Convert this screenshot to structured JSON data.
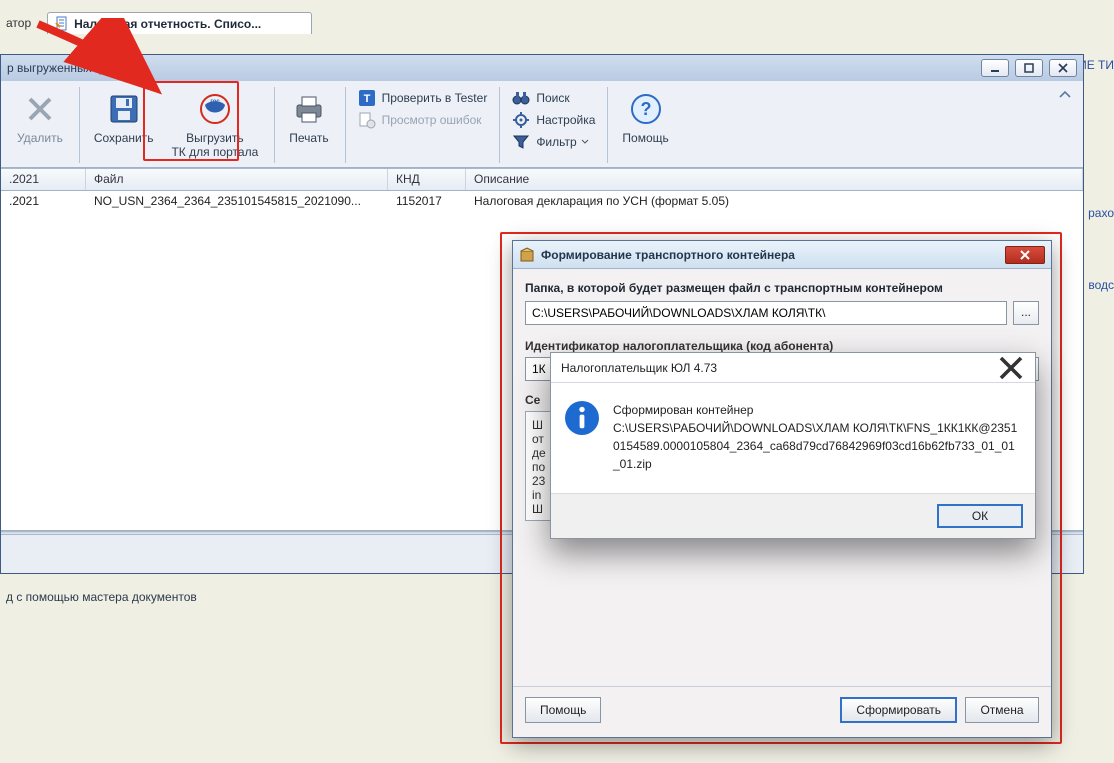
{
  "tabs": {
    "lead": "атор",
    "active": "Налоговая отчетность. Списо..."
  },
  "toolwin": {
    "title": "р выгруженных файлов"
  },
  "ribbon": {
    "delete": "Удалить",
    "save": "Сохранить",
    "export": "Выгрузить\nТК для портала",
    "print": "Печать",
    "tester": "Проверить в Tester",
    "errors": "Просмотр ошибок",
    "search": "Поиск",
    "settings": "Настройка",
    "filter": "Фильтр",
    "help": "Помощь"
  },
  "grid": {
    "headers": {
      "date": ".2021",
      "file": "Файл",
      "knd": "КНД",
      "desc": "Описание"
    },
    "rows": [
      {
        "date": ".2021",
        "file": "NO_USN_2364_2364_235101545815_2021090...",
        "knd": "1152017",
        "desc": "Налоговая декларация по УСН (формат 5.05)"
      }
    ]
  },
  "hint": "д с помощью мастера документов",
  "right_fragments": {
    "f1": "НИЕ\nТИ",
    "f2": "рахо",
    "f3": "водс"
  },
  "dialog1": {
    "title": "Формирование транспортного контейнера",
    "folder_label": "Папка, в которой будет размещен файл с транспортным контейнером",
    "folder_value": "C:\\USERS\\РАБОЧИЙ\\DOWNLOADS\\ХЛАМ КОЛЯ\\ТК\\",
    "browse": "...",
    "id_label_cut": "Идентификатор налогоплательщика (код абонента)",
    "id_value": "1К",
    "cert_label": "Се",
    "cert_lines": "Ш\nот\nде\nпо\n23\nin\nШ",
    "help": "Помощь",
    "submit": "Сформировать",
    "cancel": "Отмена"
  },
  "dialog2": {
    "title": "Налогоплательщик ЮЛ 4.73",
    "msg_l1": "Сформирован контейнер",
    "msg_l2": "C:\\USERS\\РАБОЧИЙ\\DOWNLOADS\\ХЛАМ КОЛЯ\\ТК\\FNS_1КК1КК@23510154589.0000105804_2364_ca68d79cd76842969f03cd16b62fb733_01_01_01.zip",
    "ok": "ОК"
  }
}
